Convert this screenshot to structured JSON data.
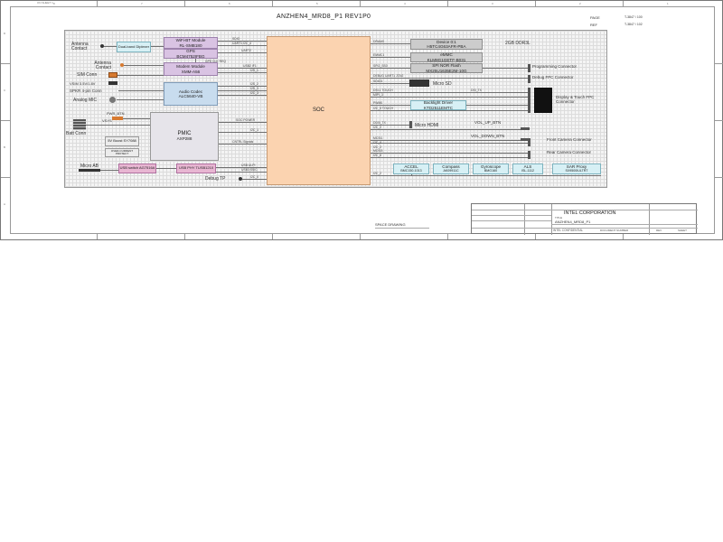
{
  "header": {
    "title": "ANZHEN4_MRD8_P1 REV1P0",
    "top_left": "ON SHEET 1",
    "top_right_1": "PAGE",
    "top_right_1_val": "T-3847 / 100",
    "top_right_2": "REF",
    "top_right_2_val": "T-3847 / 102"
  },
  "ruler": {
    "top": [
      "8",
      "7",
      "6",
      "5",
      "4",
      "3",
      "2",
      "1"
    ],
    "side": [
      "D",
      "C",
      "B",
      "A"
    ]
  },
  "left_side": {
    "antenna_contact": "Antenna Contact",
    "antenna_contact2": "Antenna Contact",
    "sim_conn": "SIM Conn",
    "vsim": "VSIM 3.5V/1.8V",
    "spkr": "SPKR 4-pin Conn",
    "analog_mic": "Analog MIC",
    "batt_conn": "Batt Conn",
    "micro_ab": "Micro AB",
    "dual_band": "Dual-band Diplexer",
    "vsys": "VSYS",
    "pwr_btn": "PWR_BTN",
    "boost": "5V Boost SY7088",
    "ovp": "OVER-CURRENT PROTECT",
    "usb_switch": "USB switch AG7516A",
    "usb_phy": "USB PHY TUSB1210",
    "debug_tp": "Debug TP"
  },
  "blocks": {
    "wifi": [
      "WiFi-BT Module",
      "RL-SMB180"
    ],
    "gps": [
      "GPS",
      "BCM4752IFBG"
    ],
    "modem": [
      "Modem Module",
      "XMM-A56"
    ],
    "audio": [
      "Audio Codec",
      "ALC5640-VB"
    ],
    "pmic": [
      "PMIC",
      "AXP288"
    ],
    "soc": "SOC",
    "ddr": [
      "Device 0:1",
      "H5TC4G63AFR-PBA"
    ],
    "ddr_side": "2GB DDR3L",
    "emmc": [
      "eMMC",
      "KLM8G1GETF-B031"
    ],
    "spi": [
      "SPI NOR Flash",
      "MX25U1635E2M-10G"
    ],
    "micro_sd": "Micro SD",
    "backlight": [
      "Backlight Driver",
      "KTD2511EMTC"
    ],
    "micro_hdmi": "Micro HDMI",
    "accel": [
      "ACCEL",
      "BMC150-1013"
    ],
    "compass": [
      "Compass",
      "AK09911C"
    ],
    "gyro": [
      "Gyroscope",
      "BMG160"
    ],
    "als": [
      "ALS",
      "ISL-1112"
    ],
    "sar": [
      "SAR Proxy",
      "SX9500IULTRT"
    ]
  },
  "right_side": {
    "programming": "Programming Connector",
    "debug_fpc": "Debug FPC Connector",
    "display": "Display & Touch FPC Connector",
    "vol_up": "VOL_UP_BTN",
    "vol_down": "VOL_DOWN_BTN",
    "front_cam": "Front Camera Connector",
    "rear_cam": "Rear Camera Connector"
  },
  "signals": {
    "soc_left": [
      "SDIO",
      "UART1 I2C_4",
      "UART2",
      "GPS CLK REQ",
      "USB2 IF1",
      "I2S_1",
      "I2S_2",
      "I2S_3",
      "I2C_3",
      "SOC POWER",
      "I2C_1",
      "CNTRL Signals",
      "USB ULPI",
      "USB3 SSIC",
      "I2C_0"
    ],
    "soc_right": [
      "DRAM0",
      "EMMC1",
      "SPI2_SS0",
      "DEBUG UART1 JTAG",
      "SDIO3",
      "DSI-1 TOUCH",
      "MIPI_3",
      "PWM0",
      "I2C_5 TOUCH",
      "DDI0_TX",
      "I2C_2",
      "MCSI1",
      "I2C_4",
      "I2C_2",
      "MCSI3",
      "I2C_6",
      "I2C_2"
    ],
    "dsi_tx": "DSI_TX"
  },
  "title_block": {
    "company": "INTEL CORPORATION",
    "doc": "ANZHEN4_MRD8_P1",
    "confidential": "INTEL CONFIDENTIAL",
    "doc_number": "DOCUMENT NUMBER",
    "rev": "REV",
    "sheet": "SHEET",
    "title": "TITLE",
    "drawing": "SPACE DRAWING"
  }
}
